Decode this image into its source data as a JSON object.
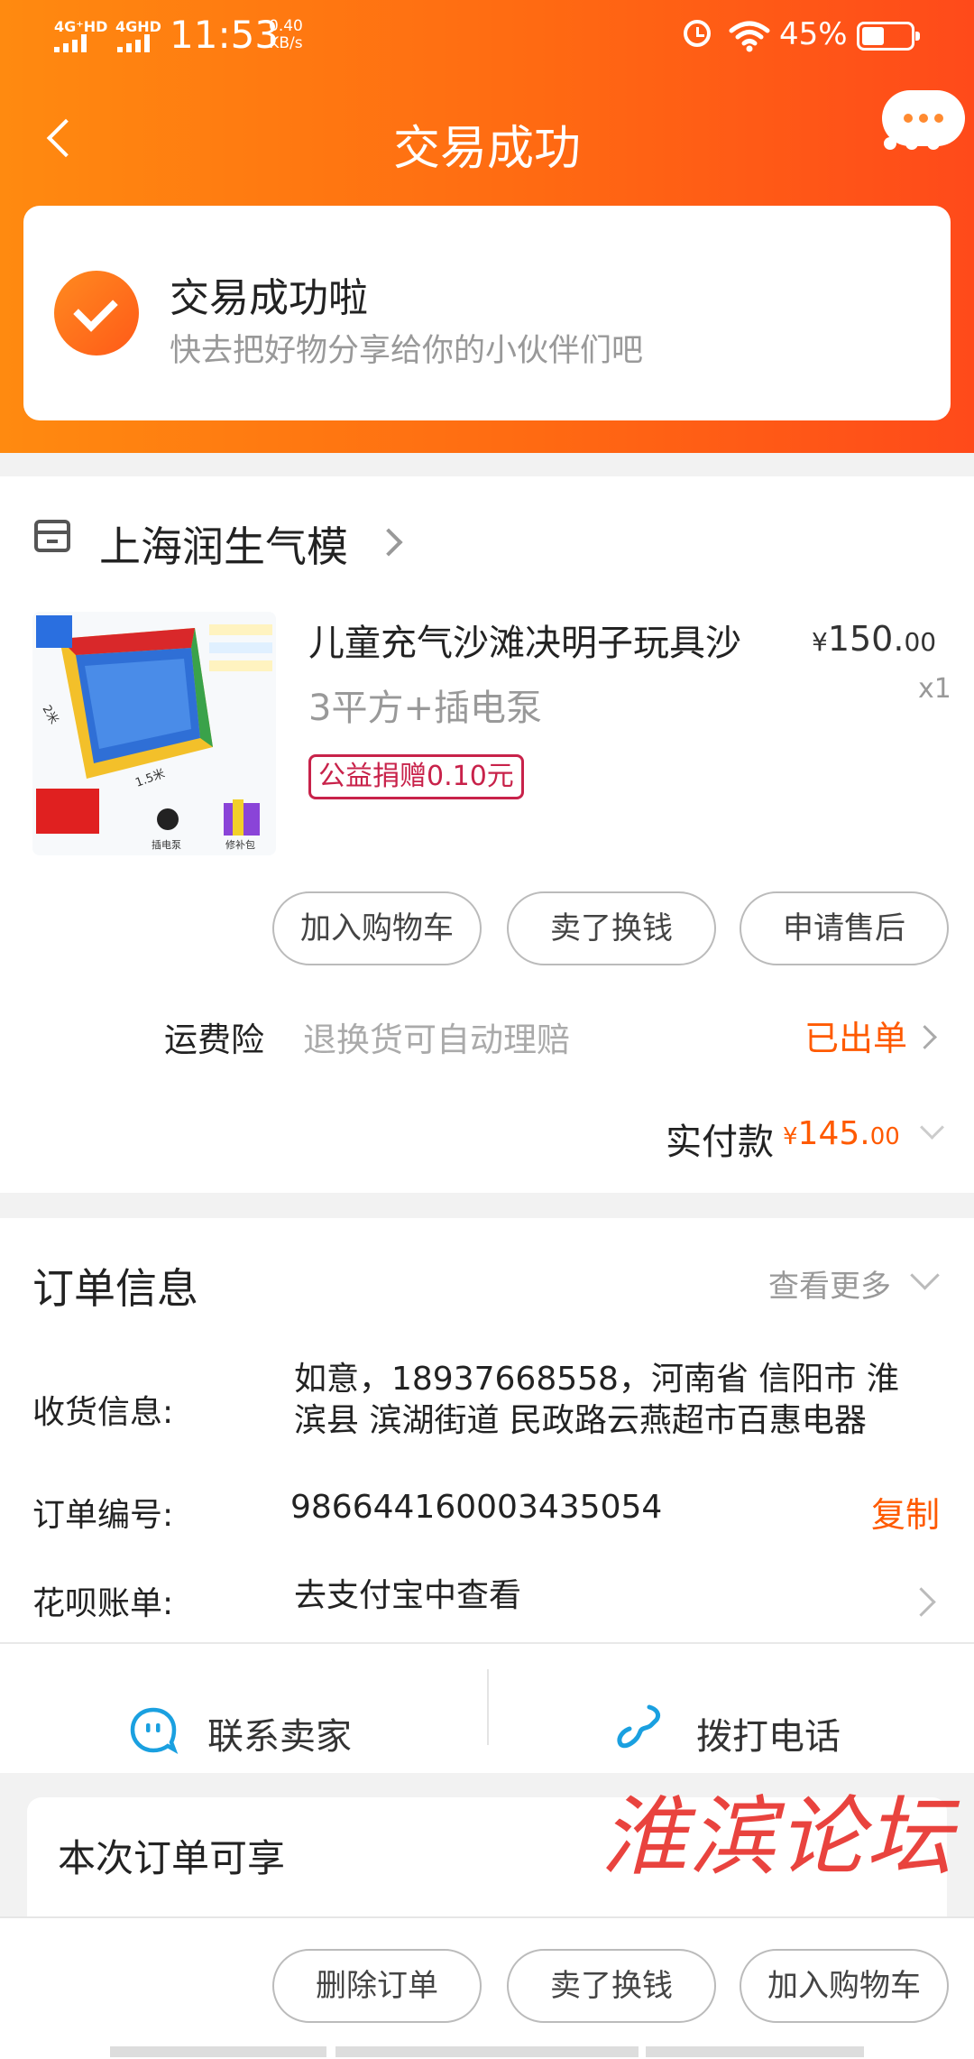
{
  "status_bar": {
    "network_1": "4G⁺HD",
    "network_2": "4GHD",
    "time": "11:53",
    "speed_value": "0.40",
    "speed_unit": "KB/s",
    "battery_percent": "45%",
    "icons": [
      "signal-icon",
      "alarm-icon",
      "wifi-icon",
      "battery-icon"
    ]
  },
  "nav": {
    "title": "交易成功",
    "back_icon": "chevron-left-icon",
    "more_icon": "more-icon"
  },
  "success": {
    "title": "交易成功啦",
    "subtitle": "快去把好物分享给你的小伙伴们吧",
    "icon": "check-circle-icon"
  },
  "order": {
    "shop_name": "上海润生气模",
    "product": {
      "title": "儿童充气沙滩决明子玩具沙",
      "spec": "3平方+插电泵",
      "price_currency": "¥",
      "price_int": "150.",
      "price_dec": "00",
      "quantity": "x1",
      "badge": "公益捐赠0.10元",
      "image_labels": {
        "dim_left": "2米",
        "dim_bottom": "1.5米",
        "pump_label": "插电泵",
        "kit_label": "修补包"
      }
    },
    "actions": [
      "加入购物车",
      "卖了换钱",
      "申请售后"
    ],
    "insurance": {
      "label": "运费险",
      "desc": "退换货可自动理赔",
      "status": "已出单"
    },
    "paid": {
      "label": "实付款",
      "currency": "¥",
      "amount_int": "145.",
      "amount_dec": "00"
    }
  },
  "order_info": {
    "title": "订单信息",
    "more": "查看更多",
    "shipping_label": "收货信息:",
    "shipping_line1": "如意，18937668558，河南省 信阳市 淮",
    "shipping_line2": "滨县 滨湖街道 民政路云燕超市百惠电器",
    "order_no_label": "订单编号:",
    "order_no": "986644160003435054",
    "copy": "复制",
    "huabei_label": "花呗账单:",
    "huabei_value": "去支付宝中查看"
  },
  "contact": {
    "seller": "联系卖家",
    "phone": "拨打电话"
  },
  "benefits": {
    "title": "本次订单可享"
  },
  "watermark": "淮滨论坛",
  "bottom_actions": [
    "删除订单",
    "卖了换钱",
    "加入购物车"
  ],
  "colors": {
    "brand_orange": "#ff6a12",
    "price_orange": "#ff5a00",
    "charity_red": "#c8224a",
    "contact_blue": "#1aa0e0"
  }
}
